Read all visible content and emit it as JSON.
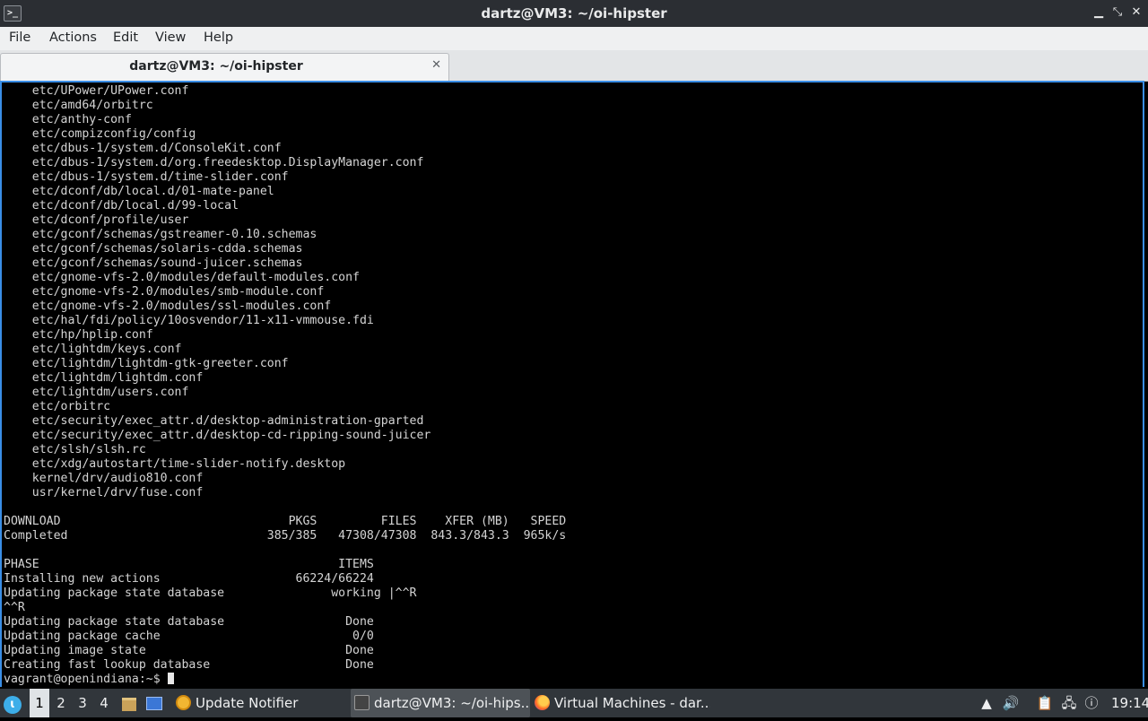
{
  "window": {
    "title": "dartz@VM3: ~/oi-hipster",
    "app_icon": ">_",
    "minimize": "▁",
    "maximize": "⤡",
    "close": "✕"
  },
  "menu": [
    "File",
    "Actions",
    "Edit",
    "View",
    "Help"
  ],
  "tab": {
    "label": "dartz@VM3: ~/oi-hipster",
    "close": "✕"
  },
  "terminal": {
    "lines": [
      "    etc/UPower/UPower.conf",
      "    etc/amd64/orbitrc",
      "    etc/anthy-conf",
      "    etc/compizconfig/config",
      "    etc/dbus-1/system.d/ConsoleKit.conf",
      "    etc/dbus-1/system.d/org.freedesktop.DisplayManager.conf",
      "    etc/dbus-1/system.d/time-slider.conf",
      "    etc/dconf/db/local.d/01-mate-panel",
      "    etc/dconf/db/local.d/99-local",
      "    etc/dconf/profile/user",
      "    etc/gconf/schemas/gstreamer-0.10.schemas",
      "    etc/gconf/schemas/solaris-cdda.schemas",
      "    etc/gconf/schemas/sound-juicer.schemas",
      "    etc/gnome-vfs-2.0/modules/default-modules.conf",
      "    etc/gnome-vfs-2.0/modules/smb-module.conf",
      "    etc/gnome-vfs-2.0/modules/ssl-modules.conf",
      "    etc/hal/fdi/policy/10osvendor/11-x11-vmmouse.fdi",
      "    etc/hp/hplip.conf",
      "    etc/lightdm/keys.conf",
      "    etc/lightdm/lightdm-gtk-greeter.conf",
      "    etc/lightdm/lightdm.conf",
      "    etc/lightdm/users.conf",
      "    etc/orbitrc",
      "    etc/security/exec_attr.d/desktop-administration-gparted",
      "    etc/security/exec_attr.d/desktop-cd-ripping-sound-juicer",
      "    etc/slsh/slsh.rc",
      "    etc/xdg/autostart/time-slider-notify.desktop",
      "    kernel/drv/audio810.conf",
      "    usr/kernel/drv/fuse.conf",
      "",
      "DOWNLOAD                                PKGS         FILES    XFER (MB)   SPEED",
      "Completed                            385/385   47308/47308  843.3/843.3  965k/s",
      "",
      "PHASE                                          ITEMS",
      "Installing new actions                   66224/66224",
      "Updating package state database               working |^^R",
      "^^R",
      "Updating package state database                 Done",
      "Updating package cache                           0/0",
      "Updating image state                            Done",
      "Creating fast lookup database                   Done"
    ],
    "prompt": "vagrant@openindiana:~$ "
  },
  "taskbar": {
    "workspaces": [
      "1",
      "2",
      "3",
      "4"
    ],
    "tasks": [
      {
        "label": "Update Notifier",
        "icon": "update-notifier-icon"
      },
      {
        "label": "dartz@VM3: ~/oi-hips...",
        "icon": "terminal-icon"
      },
      {
        "label": "Virtual Machines - dar...",
        "icon": "firefox-icon"
      }
    ],
    "clock": "19:14"
  }
}
